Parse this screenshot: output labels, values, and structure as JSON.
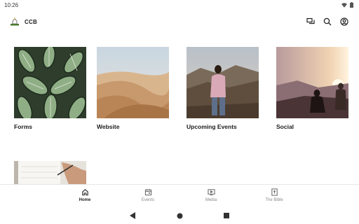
{
  "status_bar": {
    "time": "10:26"
  },
  "app": {
    "title": "CCB"
  },
  "cards": [
    {
      "label": "Forms"
    },
    {
      "label": "Website"
    },
    {
      "label": "Upcoming Events"
    },
    {
      "label": "Social"
    },
    {
      "label": ""
    }
  ],
  "bottom_nav": {
    "active": "Home",
    "items": [
      {
        "label": "Home",
        "icon": "home-icon"
      },
      {
        "label": "Events",
        "icon": "calendar-icon"
      },
      {
        "label": "Media",
        "icon": "play-icon"
      },
      {
        "label": "The Bible",
        "icon": "bible-icon"
      }
    ]
  },
  "colors": {
    "active": "#222222",
    "inactive": "#888888"
  }
}
